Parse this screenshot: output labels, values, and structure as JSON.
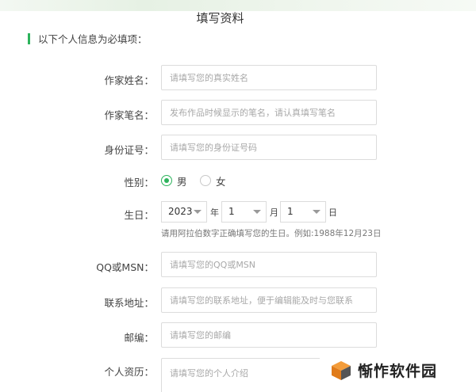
{
  "page": {
    "title": "填写资料"
  },
  "section": {
    "title": "以下个人信息为必填项："
  },
  "form": {
    "real_name": {
      "label": "作家姓名：",
      "placeholder": "请填写您的真实姓名"
    },
    "pen_name": {
      "label": "作家笔名：",
      "placeholder": "发布作品时候显示的笔名，请认真填写笔名"
    },
    "id_number": {
      "label": "身份证号：",
      "placeholder": "请填写您的身份证号码"
    },
    "gender": {
      "label": "性别：",
      "options": [
        "男",
        "女"
      ],
      "selected": "男"
    },
    "birthday": {
      "label": "生日：",
      "year": "2023",
      "year_unit": "年",
      "month": "1",
      "month_unit": "月",
      "day": "1",
      "day_unit": "日",
      "hint": "请用阿拉伯数字正确填写您的生日。例如:1988年12月23日"
    },
    "qq_msn": {
      "label": "QQ或MSN：",
      "placeholder": "请填写您的QQ或MSN"
    },
    "address": {
      "label": "联系地址：",
      "placeholder": "请填写您的联系地址，便于编辑能及时与您联系"
    },
    "postcode": {
      "label": "邮编：",
      "placeholder": "请填写您的邮编"
    },
    "resume": {
      "label": "个人资历：",
      "placeholder": "请填写您的个人介绍"
    }
  },
  "watermark": {
    "text": "惭怍软件园",
    "logo_icon": "orange-cube-logo-icon"
  },
  "colors": {
    "accent": "#2db35c"
  }
}
